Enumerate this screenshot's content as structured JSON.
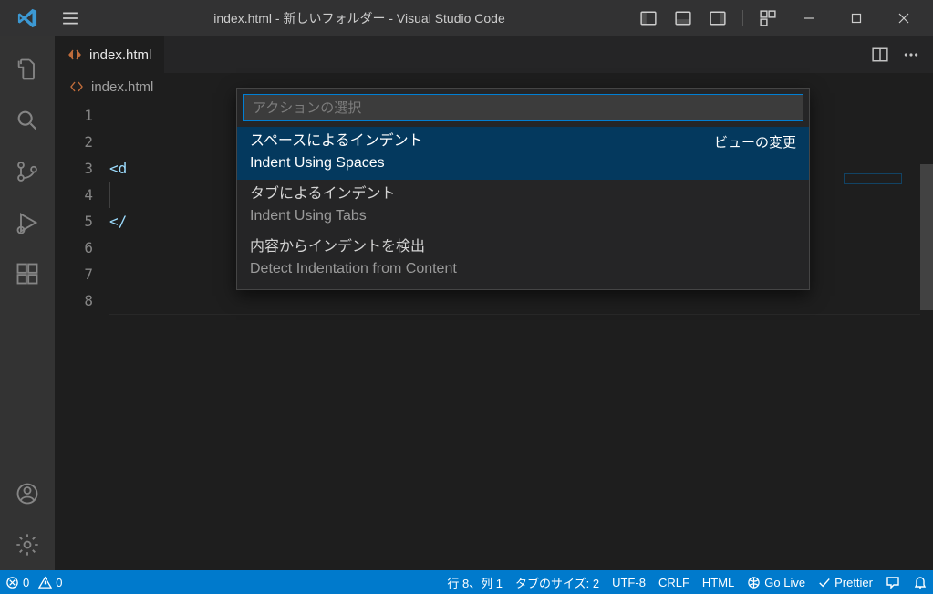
{
  "title": "index.html - 新しいフォルダー - Visual Studio Code",
  "tab": {
    "label": "index.html"
  },
  "breadcrumb": {
    "label": "index.html"
  },
  "gutter": [
    "1",
    "2",
    "3",
    "4",
    "5",
    "6",
    "7",
    "8"
  ],
  "code": {
    "lines": [
      "",
      "",
      "<d",
      "  ",
      "</",
      "",
      "",
      ""
    ],
    "currentLine": 8
  },
  "quickinput": {
    "placeholder": "アクションの選択",
    "group": "ビューの変更",
    "items": [
      {
        "label": "スペースによるインデント",
        "desc": "Indent Using Spaces",
        "selected": true,
        "group": true
      },
      {
        "label": "タブによるインデント",
        "desc": "Indent Using Tabs",
        "selected": false
      },
      {
        "label": "内容からインデントを検出",
        "desc": "Detect Indentation from Content",
        "selected": false
      }
    ]
  },
  "status": {
    "errors": "0",
    "warnings": "0",
    "cursor": "行 8、列 1",
    "tabsize": "タブのサイズ: 2",
    "encoding": "UTF-8",
    "eol": "CRLF",
    "lang": "HTML",
    "golive": "Go Live",
    "prettier": "Prettier"
  }
}
